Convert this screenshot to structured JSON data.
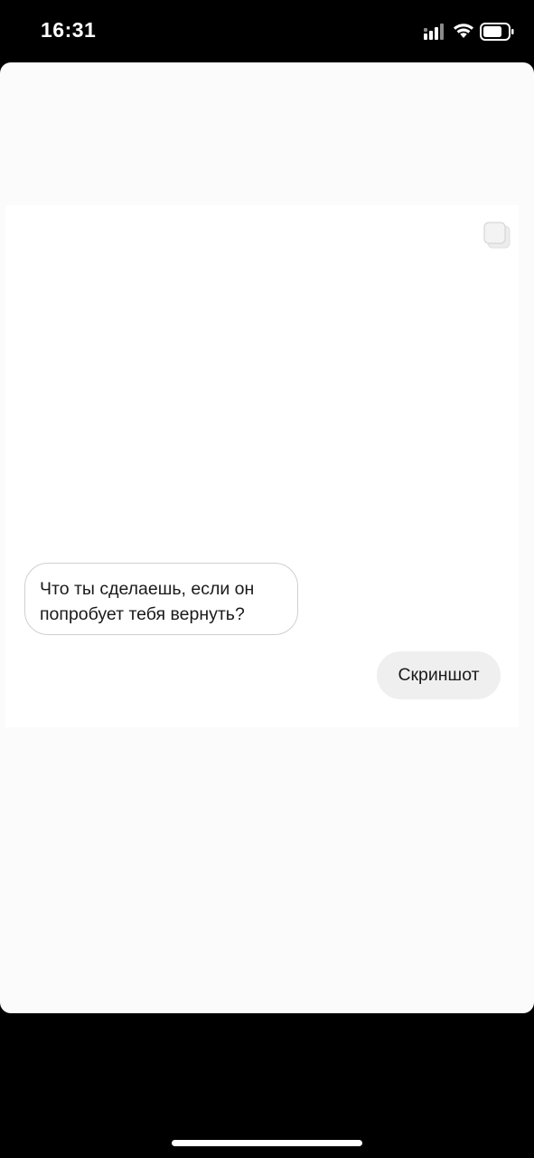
{
  "status_bar": {
    "time": "16:31",
    "icons": [
      "cellular-signal-icon",
      "wifi-icon",
      "battery-icon"
    ]
  },
  "chat": {
    "incoming_message": {
      "lines": [
        "Что ты сделаешь, если он",
        "попробует тебя вернуть?"
      ]
    },
    "outgoing_message": {
      "text": "Скриншот"
    },
    "copy_icon": "copy-icon"
  },
  "colors": {
    "status_bar_bg": "#000000",
    "sheet_bg": "#fbfbfb",
    "card_bg": "#ffffff",
    "incoming_bubble_border": "#cfcfcf",
    "outgoing_bubble_bg": "#efefef",
    "text": "#1a1a1a"
  }
}
